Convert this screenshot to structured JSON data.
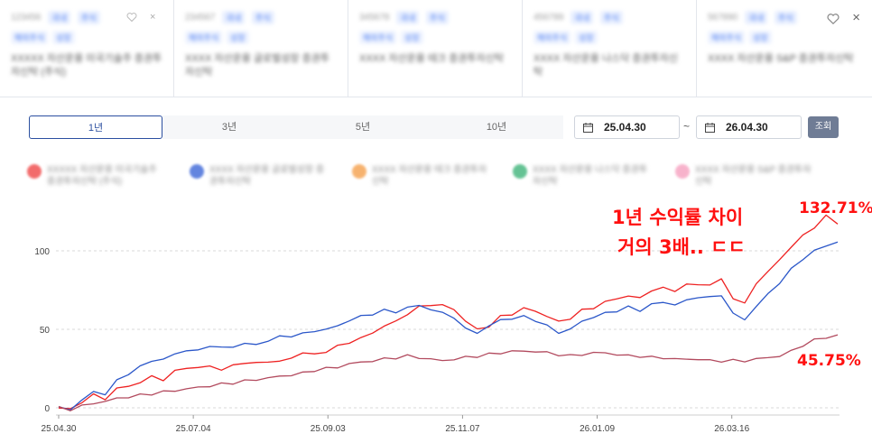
{
  "cards": [
    {
      "code": "123456",
      "tags": [
        "국내",
        "주식"
      ],
      "chips": [
        "해외주식",
        "성장"
      ],
      "name": "XXXXX 자산운용 미국기술주 증권투자신탁 (주식)"
    },
    {
      "code": "234567",
      "tags": [
        "국내",
        "주식"
      ],
      "chips": [
        "해외주식",
        "성장"
      ],
      "name": "XXXX 자산운용 글로벌성장 증권투자신탁"
    },
    {
      "code": "345678",
      "tags": [
        "국내",
        "주식"
      ],
      "chips": [
        "해외주식",
        "성장"
      ],
      "name": "XXXX 자산운용 테크 증권투자신탁"
    },
    {
      "code": "456789",
      "tags": [
        "국내",
        "주식"
      ],
      "chips": [
        "해외주식",
        "성장"
      ],
      "name": "XXXX 자산운용 나스닥 증권투자신탁"
    },
    {
      "code": "567890",
      "tags": [
        "국내",
        "주식"
      ],
      "chips": [
        "해외주식",
        "성장"
      ],
      "name": "XXXX 자산운용 S&P 증권투자신탁"
    }
  ],
  "close_label": "×",
  "tabs": [
    "1년",
    "3년",
    "5년",
    "10년"
  ],
  "active_tab": "1년",
  "date_range": {
    "start": "25.04.30",
    "separator": "~",
    "end": "26.04.30"
  },
  "search_button": "조회",
  "legend": [
    {
      "name": "XXXXX 자산운용 미국기술주 증권투자신탁 (주식)",
      "color": "#ef4747"
    },
    {
      "name": "XXXX 자산운용 글로벌성장 증권투자신탁",
      "color": "#3d67d8"
    },
    {
      "name": "XXXX 자산운용 테크 증권투자신탁",
      "color": "#f5a04c"
    },
    {
      "name": "XXXX 자산운용 나스닥 증권투자신탁",
      "color": "#3fb47a"
    },
    {
      "name": "XXXX 자산운용 S&P 증권투자신탁",
      "color": "#f6a0bf"
    }
  ],
  "annotations": {
    "line1": "1년 수익률 차이",
    "line2": "거의 3배.. ㄷㄷ",
    "top_value": "132.71%",
    "bottom_value": "45.75%"
  },
  "chart_data": {
    "type": "line",
    "x_ticks": [
      "25.04.30",
      "25.07.04",
      "25.09.03",
      "25.11.07",
      "26.01.09",
      "26.03.16"
    ],
    "y_ticks": [
      0,
      50,
      100
    ],
    "ylim": [
      -5,
      135
    ],
    "grid": true,
    "colors": {
      "red": "#ee2222",
      "blue": "#2b57c9",
      "mauve": "#b24a5e"
    },
    "series": [
      {
        "key": "red",
        "values": [
          0,
          -1,
          4,
          8,
          6,
          12,
          14,
          16,
          20,
          18,
          23,
          26,
          25,
          27,
          24,
          27,
          29,
          28,
          30,
          29,
          32,
          35,
          34,
          36,
          39,
          42,
          44,
          48,
          52,
          55,
          60,
          64,
          66,
          65,
          63,
          55,
          50,
          52,
          58,
          60,
          63,
          62,
          58,
          55,
          57,
          62,
          64,
          67,
          70,
          71,
          70,
          75,
          76,
          75,
          78,
          79,
          78,
          82,
          70,
          66,
          80,
          86,
          95,
          102,
          110,
          115,
          122,
          118
        ]
      },
      {
        "key": "blue",
        "values": [
          0,
          -1,
          5,
          10,
          9,
          17,
          22,
          26,
          30,
          31,
          34,
          37,
          36,
          40,
          38,
          39,
          41,
          40,
          43,
          45,
          46,
          47,
          49,
          50,
          52,
          56,
          58,
          60,
          62,
          61,
          64,
          65,
          63,
          60,
          58,
          50,
          48,
          52,
          56,
          57,
          58,
          56,
          52,
          48,
          50,
          55,
          58,
          60,
          62,
          64,
          62,
          66,
          67,
          66,
          68,
          71,
          70,
          72,
          60,
          56,
          65,
          72,
          80,
          88,
          95,
          100,
          103,
          106
        ]
      },
      {
        "key": "mauve",
        "values": [
          0,
          -1,
          1,
          3,
          4,
          6,
          7,
          8,
          9,
          10,
          11,
          12,
          13,
          14,
          15,
          16,
          17,
          18,
          19,
          20,
          21,
          22,
          24,
          25,
          26,
          28,
          29,
          30,
          31,
          32,
          33,
          32,
          31,
          30,
          31,
          32,
          33,
          34,
          35,
          36,
          36,
          36,
          35,
          34,
          33,
          34,
          35,
          35,
          34,
          33,
          33,
          32,
          32,
          31,
          31,
          31,
          30,
          30,
          30,
          30,
          31,
          32,
          33,
          36,
          40,
          43,
          45,
          46
        ]
      }
    ]
  }
}
